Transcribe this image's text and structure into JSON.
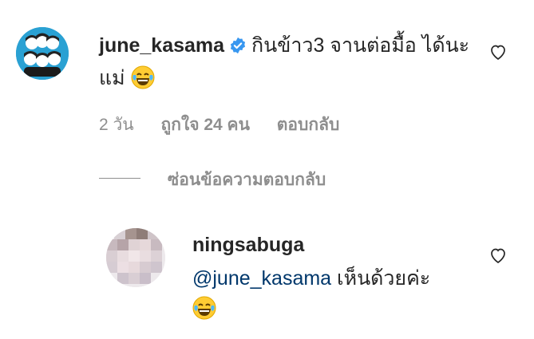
{
  "comment": {
    "username": "june_kasama",
    "text": "กินข้าว3 จานต่อมื้อ ได้นะแม่",
    "emoji": "laughing-tears-emoji",
    "time": "2 วัน",
    "likes": "ถูกใจ 24 คน",
    "reply_label": "ตอบกลับ",
    "hide_replies_label": "ซ่อนข้อความตอบกลับ"
  },
  "reply": {
    "username": "ningsabuga",
    "mention": "@june_kasama",
    "text": "เห็นด้วยค่ะ",
    "emoji": "laughing-tears-emoji"
  },
  "colors": {
    "secondary_text": "#8e8e8e",
    "mention": "#00376b",
    "verified": "#3897f0",
    "avatar_bg": "#2aa1d3"
  }
}
